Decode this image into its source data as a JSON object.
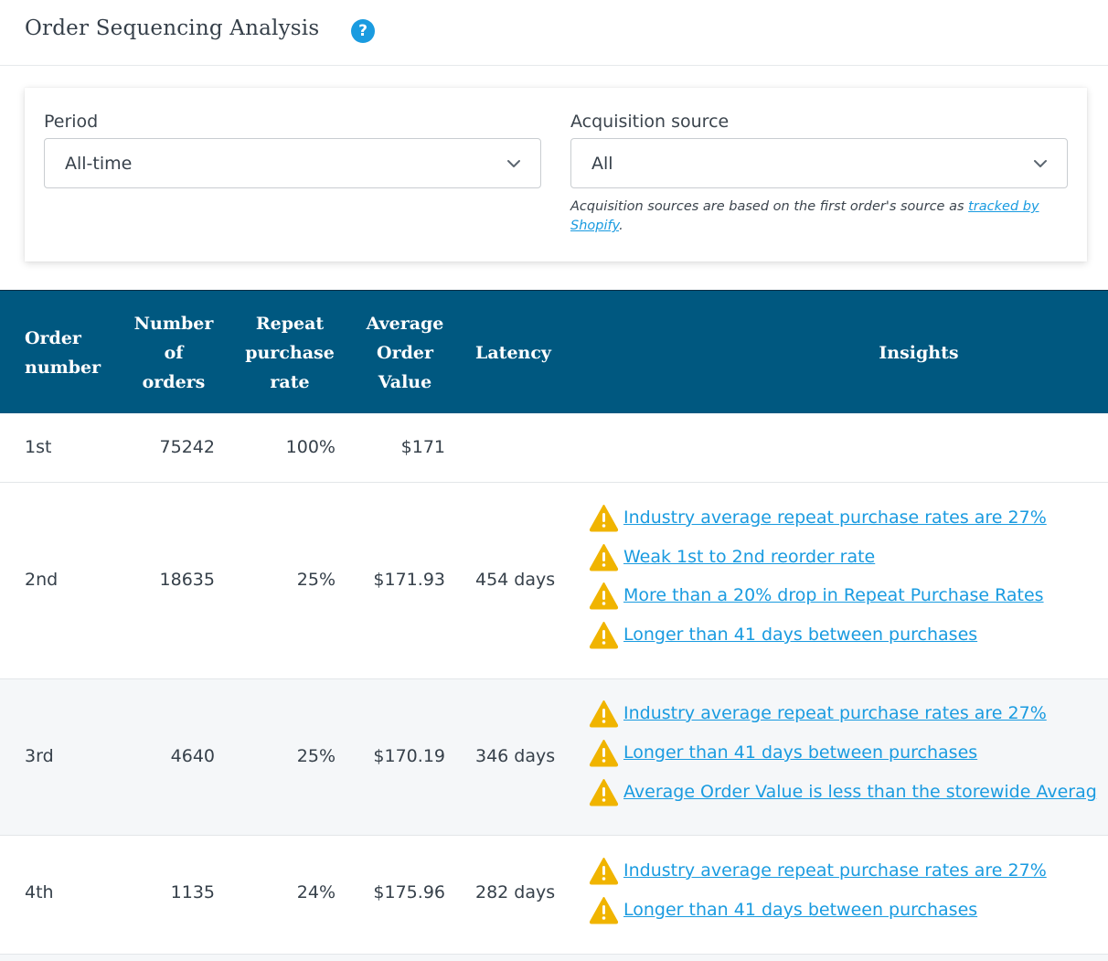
{
  "header": {
    "title": "Order Sequencing Analysis",
    "help_glyph": "?"
  },
  "filters": {
    "period": {
      "label": "Period",
      "value": "All-time"
    },
    "source": {
      "label": "Acquisition source",
      "value": "All",
      "note_text": "Acquisition sources are based on the first order's source as ",
      "note_link": "tracked by Shopify",
      "note_end": "."
    }
  },
  "table": {
    "columns": {
      "order_number": [
        "Order",
        "number"
      ],
      "num_orders": [
        "Number",
        "of",
        "orders"
      ],
      "repeat_rate": [
        "Repeat",
        "purchase",
        "rate"
      ],
      "aov": [
        "Average",
        "Order",
        "Value"
      ],
      "latency": "Latency",
      "insights": "Insights"
    },
    "rows": [
      {
        "order": "1st",
        "orders": "75242",
        "rate": "100%",
        "aov": "$171",
        "latency": "",
        "insights": []
      },
      {
        "order": "2nd",
        "orders": "18635",
        "rate": "25%",
        "aov": "$171.93",
        "latency": "454 days",
        "insights": [
          "Industry average repeat purchase rates are 27%",
          "Weak 1st to 2nd reorder rate",
          "More than a 20% drop in Repeat Purchase Rates",
          "Longer than 41 days between purchases"
        ]
      },
      {
        "order": "3rd",
        "orders": "4640",
        "rate": "25%",
        "aov": "$170.19",
        "latency": "346 days",
        "insights": [
          "Industry average repeat purchase rates are 27%",
          "Longer than 41 days between purchases",
          "Average Order Value is less than the storewide Averag"
        ]
      },
      {
        "order": "4th",
        "orders": "1135",
        "rate": "24%",
        "aov": "$175.96",
        "latency": "282 days",
        "insights": [
          "Industry average repeat purchase rates are 27%",
          "Longer than 41 days between purchases"
        ]
      }
    ]
  },
  "icons": {
    "help": "question-circle-icon",
    "select": "chevron-down-icon",
    "insight": "warning-triangle-icon"
  },
  "colors": {
    "accent": "#1a9be0",
    "table_header": "#005880",
    "warning": "#f0b400"
  }
}
